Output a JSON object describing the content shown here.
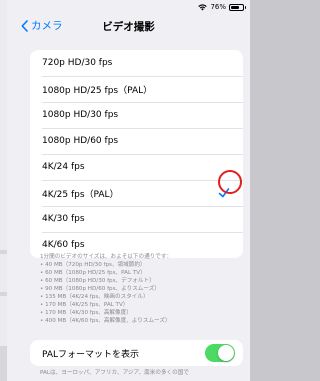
{
  "status_bar": {
    "battery_text": "76%",
    "battery_level": 0.76
  },
  "nav": {
    "back_label": "カメラ",
    "title": "ビデオ撮影"
  },
  "options": [
    {
      "label": "720p HD/30 fps",
      "selected": false
    },
    {
      "label": "1080p HD/25 fps（PAL）",
      "selected": false
    },
    {
      "label": "1080p HD/30 fps",
      "selected": false
    },
    {
      "label": "1080p HD/60 fps",
      "selected": false
    },
    {
      "label": "4K/24 fps",
      "selected": false
    },
    {
      "label": "4K/25 fps（PAL）",
      "selected": true
    },
    {
      "label": "4K/30 fps",
      "selected": false
    },
    {
      "label": "4K/60 fps",
      "selected": false
    }
  ],
  "footnote": {
    "intro": "1分間のビデオのサイズは、およそ以下の通りです：",
    "items": [
      "• 40 MB（720p HD/30 fps、領域節約）",
      "• 60 MB（1080p HD/25 fps、PAL TV）",
      "• 60 MB（1080p HD/30 fps、デフォルト）",
      "• 90 MB（1080p HD/60 fps、よりスムーズ）",
      "• 135 MB（4K/24 fps、映画のスタイル）",
      "• 170 MB（4K/25 fps、PAL TV）",
      "• 170 MB（4K/30 fps、高解像度）",
      "• 400 MB（4K/60 fps、高解像度、よりスムーズ）"
    ]
  },
  "pal_toggle": {
    "label": "PALフォーマットを表示",
    "on": true
  },
  "bottom_note": "PALは、ヨーロッパ、アフリカ、アジア、南米の多くの国で"
}
